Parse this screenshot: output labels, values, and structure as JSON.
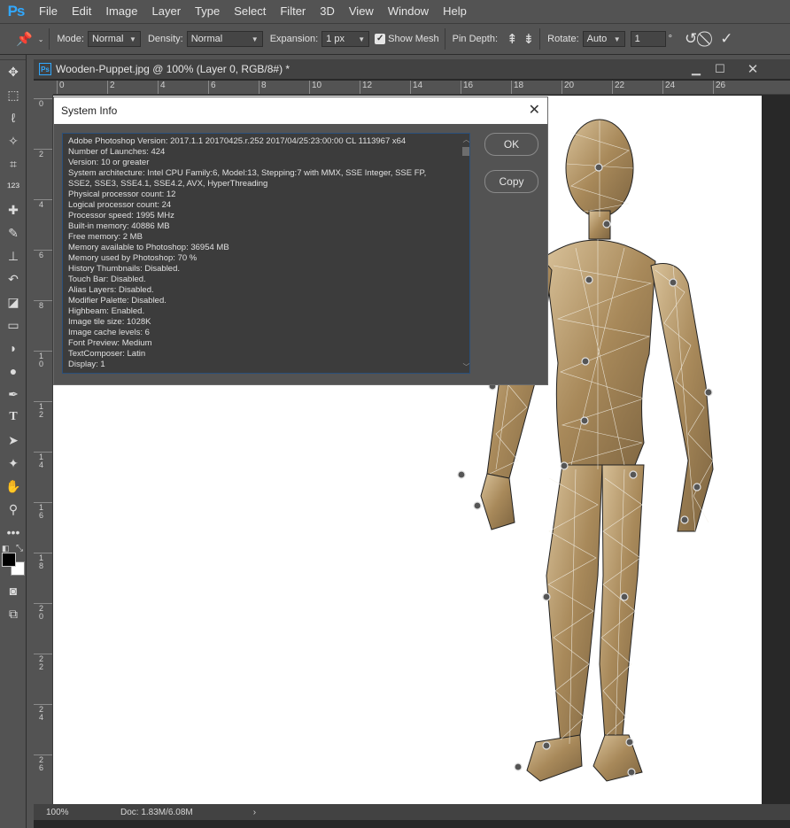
{
  "app": {
    "logo": "Ps"
  },
  "menu": [
    "File",
    "Edit",
    "Image",
    "Layer",
    "Type",
    "Select",
    "Filter",
    "3D",
    "View",
    "Window",
    "Help"
  ],
  "options": {
    "mode_label": "Mode:",
    "mode_value": "Normal",
    "density_label": "Density:",
    "density_value": "Normal",
    "expansion_label": "Expansion:",
    "expansion_value": "1 px",
    "show_mesh_label": "Show Mesh",
    "show_mesh_checked": true,
    "pin_depth_label": "Pin Depth:",
    "rotate_label": "Rotate:",
    "rotate_value": "Auto",
    "rotate_angle": "1",
    "degree_symbol": "°"
  },
  "tools": [
    "move-tool",
    "marquee-tool",
    "lasso-tool",
    "magic-wand-tool",
    "crop-tool",
    "eyedropper-tool",
    "healing-brush-tool",
    "brush-tool",
    "clone-stamp-tool",
    "history-brush-tool",
    "eraser-tool",
    "gradient-tool",
    "blur-tool",
    "dodge-tool",
    "pen-tool",
    "type-tool",
    "path-selection-tool",
    "shape-tool",
    "hand-tool",
    "zoom-tool",
    "more-tools"
  ],
  "document": {
    "title": "Wooden-Puppet.jpg @ 100% (Layer 0, RGB/8#) *",
    "ruler_h": [
      "0",
      "2",
      "4",
      "6",
      "8",
      "10",
      "12",
      "14",
      "16",
      "18",
      "20",
      "22",
      "24",
      "26"
    ],
    "ruler_v": [
      "0",
      "2",
      "4",
      "6",
      "8",
      "1\n0",
      "1\n2",
      "1\n4",
      "1\n6",
      "1\n8",
      "2\n0",
      "2\n2",
      "2\n4",
      "2\n6"
    ],
    "zoom": "100%",
    "doc_size": "Doc: 1.83M/6.08M"
  },
  "dialog": {
    "title": "System Info",
    "ok_label": "OK",
    "copy_label": "Copy",
    "lines": [
      "Adobe Photoshop Version: 2017.1.1 20170425.r.252 2017/04/25:23:00:00 CL 1113967  x64",
      "Number of Launches: 424",
      "Version: 10 or greater",
      "System architecture: Intel CPU Family:6, Model:13, Stepping:7 with MMX, SSE Integer, SSE FP,",
      "SSE2, SSE3, SSE4.1, SSE4.2, AVX, HyperThreading",
      "Physical processor count: 12",
      "Logical processor count: 24",
      "Processor speed: 1995 MHz",
      "Built-in memory: 40886 MB",
      "Free memory: 2 MB",
      "Memory available to Photoshop: 36954 MB",
      "Memory used by Photoshop: 70 %",
      "History Thumbnails: Disabled.",
      "Touch Bar: Disabled.",
      "Alias Layers: Disabled.",
      "Modifier Palette: Disabled.",
      "Highbeam: Enabled.",
      "Image tile size: 1028K",
      "Image cache levels: 6",
      "Font Preview: Medium",
      "TextComposer: Latin",
      "Display: 1"
    ]
  },
  "colors": {
    "accent": "#31a8ff",
    "panel": "#535353",
    "puppet_wood": "#b89a6c"
  }
}
